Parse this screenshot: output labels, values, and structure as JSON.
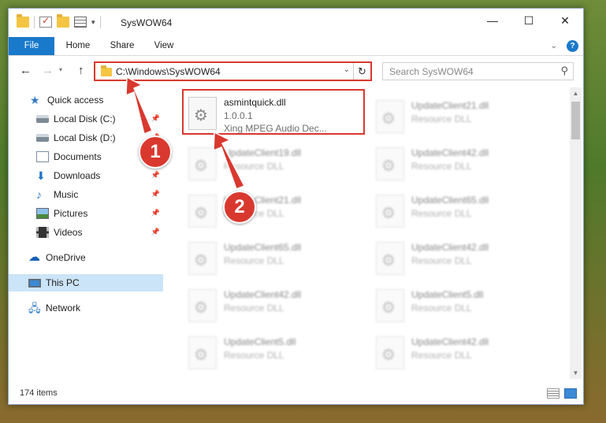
{
  "window": {
    "title": "SysWOW64",
    "controls": {
      "minimize": "—",
      "maximize": "☐",
      "close": "✕"
    }
  },
  "ribbon": {
    "tabs": [
      "File",
      "Home",
      "Share",
      "View"
    ],
    "help": "?"
  },
  "address_bar": {
    "path": "C:\\Windows\\SysWOW64"
  },
  "search": {
    "placeholder": "Search SysWOW64"
  },
  "sidebar": {
    "items": [
      {
        "label": "Quick access",
        "icon": "star-icon"
      },
      {
        "label": "Local Disk (C:)",
        "icon": "disk-icon",
        "pinned": true
      },
      {
        "label": "Local Disk (D:)",
        "icon": "disk-icon",
        "pinned": true
      },
      {
        "label": "Documents",
        "icon": "documents-icon",
        "pinned": true
      },
      {
        "label": "Downloads",
        "icon": "download-icon",
        "pinned": true
      },
      {
        "label": "Music",
        "icon": "music-icon",
        "pinned": true
      },
      {
        "label": "Pictures",
        "icon": "pictures-icon",
        "pinned": true
      },
      {
        "label": "Videos",
        "icon": "videos-icon",
        "pinned": true
      },
      {
        "label": "OneDrive",
        "icon": "onedrive-icon"
      },
      {
        "label": "This PC",
        "icon": "computer-icon",
        "selected": true
      },
      {
        "label": "Network",
        "icon": "network-icon"
      }
    ]
  },
  "files": [
    {
      "name": "asmintquick.dll",
      "line2": "1.0.0.1",
      "line3": "Xing MPEG Audio Dec...",
      "highlighted": true
    },
    {
      "name": "UpdateClient21.dll",
      "line2": "Resource DLL"
    },
    {
      "name": "UpdateClient19.dll",
      "line2": "Resource DLL"
    },
    {
      "name": "UpdateClient42.dll",
      "line2": "Resource DLL"
    },
    {
      "name": "UpdateClient21.dll",
      "line2": "Resource DLL"
    },
    {
      "name": "UpdateClient65.dll",
      "line2": "Resource DLL"
    },
    {
      "name": "UpdateClient65.dll",
      "line2": "Resource DLL"
    },
    {
      "name": "UpdateClient42.dll",
      "line2": "Resource DLL"
    },
    {
      "name": "UpdateClient42.dll",
      "line2": "Resource DLL"
    },
    {
      "name": "UpdateClient5.dll",
      "line2": "Resource DLL"
    },
    {
      "name": "UpdateClient5.dll",
      "line2": "Resource DLL"
    },
    {
      "name": "UpdateClient42.dll",
      "line2": "Resource DLL"
    }
  ],
  "status": {
    "item_count": "174 items"
  },
  "annotations": [
    "1",
    "2"
  ],
  "colors": {
    "accent": "#1979ca",
    "highlight": "#d9382f",
    "selection": "#cce4f7"
  }
}
